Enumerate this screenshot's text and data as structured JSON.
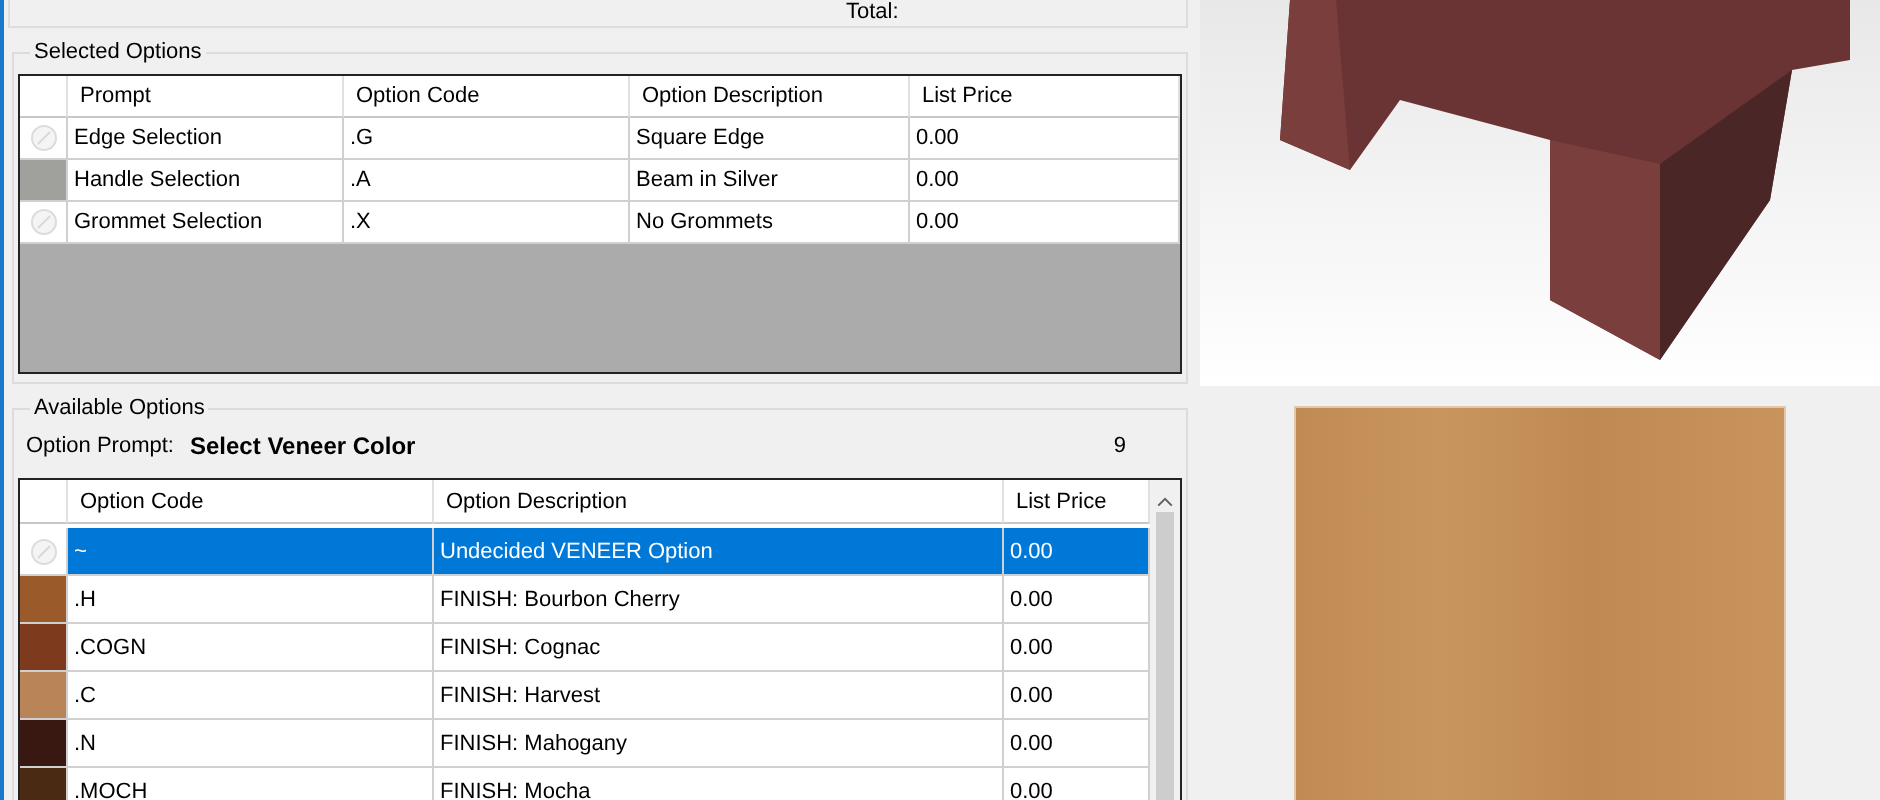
{
  "summary": {
    "total_label": "Total:"
  },
  "selected_options": {
    "title": "Selected Options",
    "columns": [
      "Prompt",
      "Option Code",
      "Option Description",
      "List Price"
    ],
    "rows": [
      {
        "kind": "icon",
        "cells": [
          "Edge Selection",
          ".G",
          "Square Edge",
          "0.00"
        ]
      },
      {
        "kind": "swatch",
        "color": "#a0a09c",
        "cells": [
          "Handle Selection",
          ".A",
          "Beam in Silver",
          "0.00"
        ]
      },
      {
        "kind": "icon",
        "cells": [
          "Grommet Selection",
          ".X",
          "No Grommets",
          "0.00"
        ]
      }
    ]
  },
  "available_options": {
    "title": "Available Options",
    "prompt_label": "Option Prompt:",
    "prompt_value": "Select Veneer Color",
    "count": "9",
    "columns": [
      "Option Code",
      "Option Description",
      "List Price"
    ],
    "rows": [
      {
        "kind": "icon",
        "selected": true,
        "cells": [
          "~",
          "Undecided VENEER Option",
          "0.00"
        ]
      },
      {
        "kind": "swatch",
        "color": "#9a5a2a",
        "selected": false,
        "cells": [
          ".H",
          "FINISH: Bourbon Cherry",
          "0.00"
        ]
      },
      {
        "kind": "swatch",
        "color": "#7e3a1c",
        "selected": false,
        "cells": [
          ".COGN",
          "FINISH: Cognac",
          "0.00"
        ]
      },
      {
        "kind": "swatch",
        "color": "#b98457",
        "selected": false,
        "cells": [
          ".C",
          "FINISH: Harvest",
          "0.00"
        ]
      },
      {
        "kind": "swatch",
        "color": "#3a1812",
        "selected": false,
        "cells": [
          ".N",
          "FINISH: Mahogany",
          "0.00"
        ]
      },
      {
        "kind": "swatch",
        "color": "#4a2a12",
        "selected": false,
        "cells": [
          ".MOCH",
          "FINISH: Mocha",
          "0.00"
        ]
      }
    ]
  }
}
